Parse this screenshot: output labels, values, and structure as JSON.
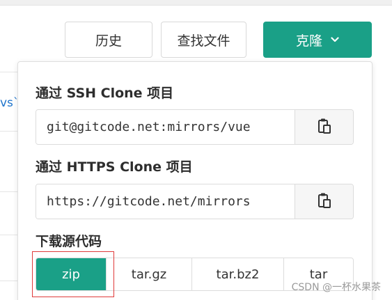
{
  "toolbar": {
    "history_label": "历史",
    "find_file_label": "查找文件",
    "clone_label": "克隆"
  },
  "background": {
    "fragment": "vs`"
  },
  "clone_panel": {
    "ssh": {
      "title": "通过 SSH Clone 项目",
      "url": "git@gitcode.net:mirrors/vue"
    },
    "https": {
      "title": "通过 HTTPS Clone 项目",
      "url": "https://gitcode.net/mirrors"
    },
    "download": {
      "title": "下载源代码",
      "formats": [
        "zip",
        "tar.gz",
        "tar.bz2",
        "tar"
      ],
      "selected": "zip"
    }
  },
  "watermark": "CSDN @一杯水果茶",
  "colors": {
    "accent": "#1aa087",
    "highlight": "#e03a3a"
  },
  "icons": {
    "clone_dropdown": "chevron-down-icon",
    "copy": "clipboard-icon"
  }
}
